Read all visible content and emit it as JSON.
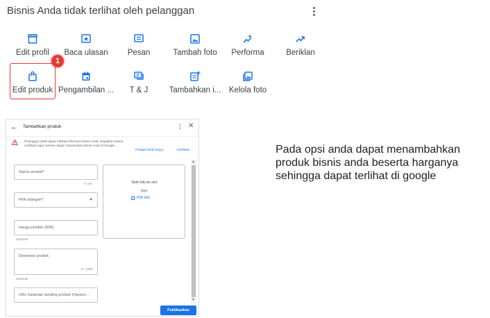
{
  "header": {
    "title": "Bisnis Anda tidak terlihat oleh pelanggan"
  },
  "actions_row1": [
    {
      "label": "Edit profil",
      "icon": "storefront-icon"
    },
    {
      "label": "Baca ulasan",
      "icon": "review-star-icon"
    },
    {
      "label": "Pesan",
      "icon": "message-icon"
    },
    {
      "label": "Tambah foto",
      "icon": "add-photo-icon"
    },
    {
      "label": "Performa",
      "icon": "performance-sparkle-icon"
    },
    {
      "label": "Beriklan",
      "icon": "trending-up-icon"
    }
  ],
  "actions_row2": [
    {
      "label": "Edit produk",
      "icon": "shopping-bag-icon"
    },
    {
      "label": "Pengambilan ...",
      "icon": "calendar-icon"
    },
    {
      "label": "T & J",
      "icon": "qa-chat-icon"
    },
    {
      "label": "Tambahkan i...",
      "icon": "add-post-icon"
    },
    {
      "label": "Kelola foto",
      "icon": "photo-library-icon"
    }
  ],
  "step_badge": "1",
  "accent_color": "#1a73e8",
  "highlight_color": "#e53935",
  "dialog": {
    "title": "Tambahkan produk",
    "back_glyph": "←",
    "more_glyph": "⋮",
    "close_glyph": "✕",
    "warning_text": "Pelanggan tidak dapat melihat informasi bisnis Anda. Dapatkan status verifikasi agar mereka dapat menemukan bisnis Anda di Google.",
    "learn_more": "Pelajari lebih lanjut",
    "verify": "Verifikasi",
    "product_name_placeholder": "Nama produk*",
    "product_name_counter": "0 / 58",
    "category_placeholder": "Pilih kategori*",
    "price_placeholder": "Harga produk (IDR)",
    "price_hint": "Opsional",
    "description_placeholder": "Deskripsi produk",
    "description_counter": "0 / 1000",
    "description_hint": "Opsional",
    "url_placeholder": "URL halaman landing produk (Opsion...",
    "photo_drag": "Tarik foto ke sini",
    "photo_or": "atau",
    "photo_pick": "Pilih foto",
    "publish_label": "Publikasikan"
  },
  "caption": "Pada opsi anda dapat menambahkan produk bisnis anda beserta harganya sehingga dapat terlihat di google"
}
